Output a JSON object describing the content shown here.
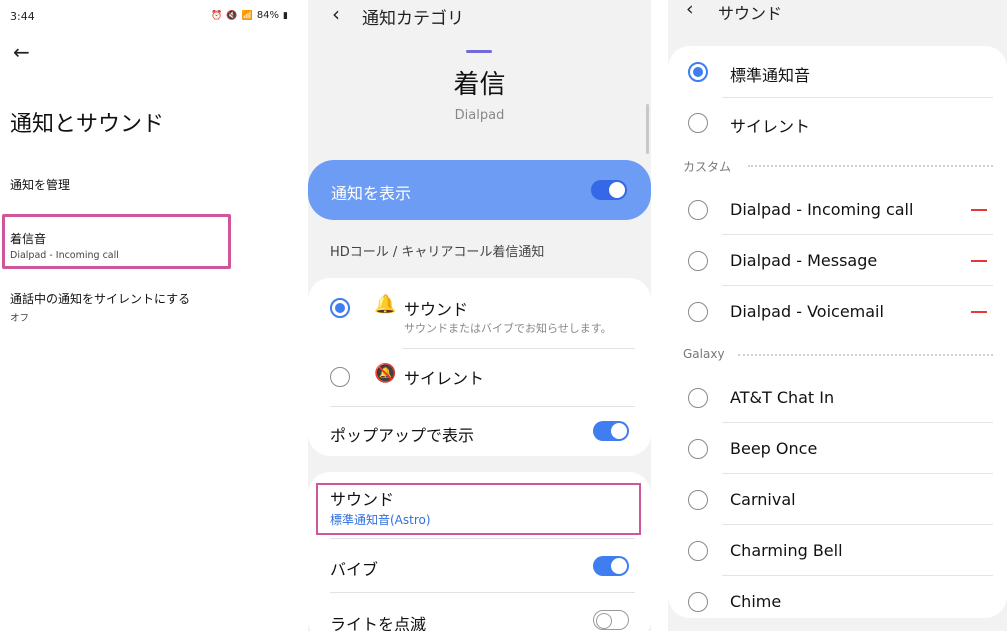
{
  "panel1": {
    "status": {
      "time": "3:44",
      "battery": "84%"
    },
    "title": "通知とサウンド",
    "items": [
      {
        "title": "通知を管理",
        "subtitle": ""
      },
      {
        "title": "着信音",
        "subtitle": "Dialpad - Incoming call"
      },
      {
        "title": "通話中の通知をサイレントにする",
        "subtitle": "オフ"
      }
    ]
  },
  "panel2": {
    "header_title": "通知カテゴリ",
    "big_title": "着信",
    "app_name": "Dialpad",
    "show_notifications": {
      "label": "通知を表示",
      "on": true
    },
    "section_label": "HDコール / キャリアコール着信通知",
    "sound_option": {
      "label": "サウンド",
      "desc": "サウンドまたはバイブでお知らせします。",
      "selected": true
    },
    "silent_option": {
      "label": "サイレント",
      "selected": false
    },
    "popup": {
      "label": "ポップアップで表示",
      "on": true
    },
    "sound_setting": {
      "label": "サウンド",
      "value": "標準通知音(Astro)"
    },
    "vibrate": {
      "label": "バイブ",
      "on": true
    },
    "light": {
      "label": "ライトを点滅",
      "on": false
    }
  },
  "panel3": {
    "header_title": "サウンド",
    "top_options": [
      {
        "label": "標準通知音",
        "selected": true
      },
      {
        "label": "サイレント",
        "selected": false
      }
    ],
    "custom_label": "カスタム",
    "custom_options": [
      {
        "label": "Dialpad - Incoming call"
      },
      {
        "label": "Dialpad - Message"
      },
      {
        "label": "Dialpad - Voicemail"
      }
    ],
    "galaxy_label": "Galaxy",
    "galaxy_options": [
      {
        "label": "AT&T Chat In"
      },
      {
        "label": "Beep Once"
      },
      {
        "label": "Carnival"
      },
      {
        "label": "Charming Bell"
      },
      {
        "label": "Chime"
      }
    ]
  },
  "colors": {
    "accent": "#3f7df0",
    "highlight": "#d0569b",
    "banner": "#6c9cf4",
    "remove": "#e23a3a"
  }
}
